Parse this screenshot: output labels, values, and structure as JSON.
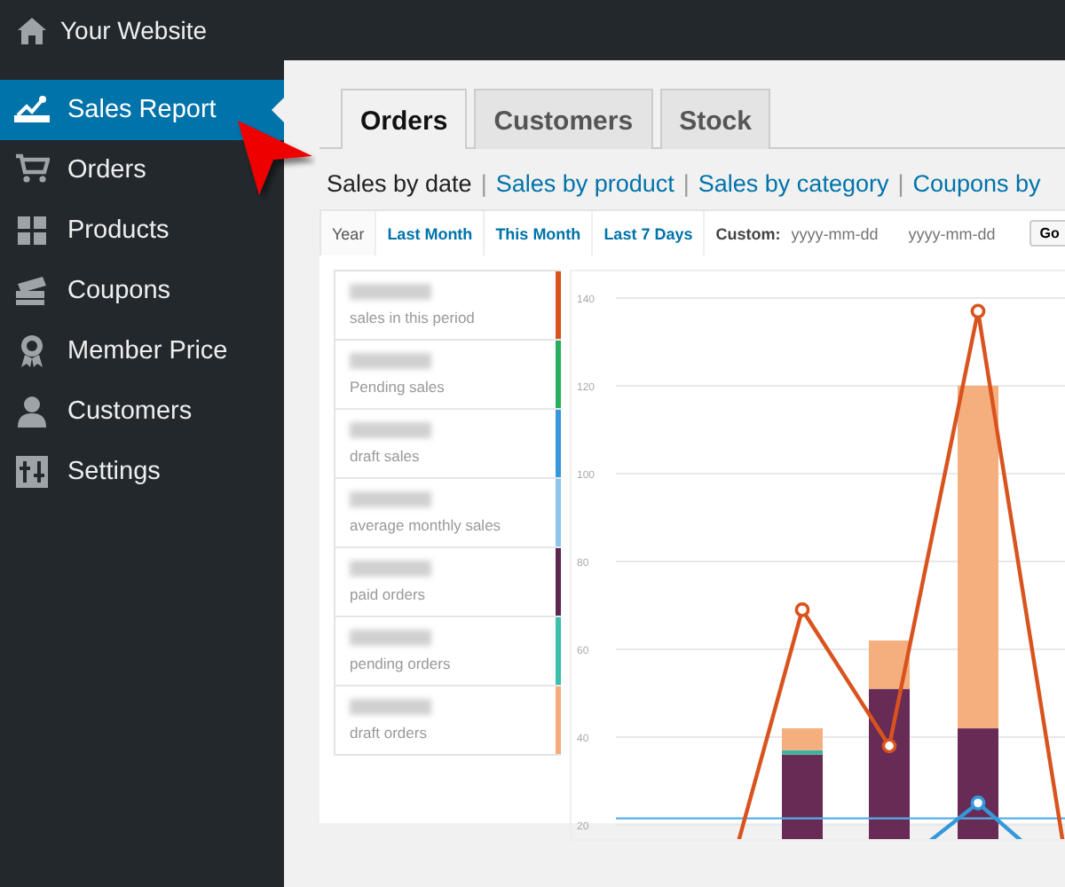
{
  "header": {
    "site_title": "Your Website"
  },
  "sidebar": {
    "items": [
      {
        "label": "Sales Report",
        "selected": true
      },
      {
        "label": "Orders",
        "selected": false
      },
      {
        "label": "Products",
        "selected": false
      },
      {
        "label": "Coupons",
        "selected": false
      },
      {
        "label": "Member Price",
        "selected": false
      },
      {
        "label": "Customers",
        "selected": false
      },
      {
        "label": "Settings",
        "selected": false
      }
    ]
  },
  "tabs": [
    {
      "label": "Orders",
      "selected": true
    },
    {
      "label": "Customers",
      "selected": false
    },
    {
      "label": "Stock",
      "selected": false
    }
  ],
  "report_nav": {
    "separator": "|",
    "links": [
      {
        "label": "Sales by date",
        "selected": true
      },
      {
        "label": "Sales by product",
        "selected": false
      },
      {
        "label": "Sales by category",
        "selected": false
      },
      {
        "label": "Coupons by",
        "selected": false
      }
    ]
  },
  "range_filter": {
    "ranges": [
      {
        "label": "Year",
        "selected": true
      },
      {
        "label": "Last Month",
        "selected": false
      },
      {
        "label": "This Month",
        "selected": false
      },
      {
        "label": "Last 7 Days",
        "selected": false
      }
    ],
    "custom_label": "Custom:",
    "start": {
      "placeholder": "yyyy-mm-dd"
    },
    "end": {
      "placeholder": "yyyy-mm-dd"
    },
    "go_button": "Go"
  },
  "summary": [
    {
      "label": "sales in this period",
      "color": "#d9531e"
    },
    {
      "label": "Pending sales",
      "color": "#27ae60"
    },
    {
      "label": "draft sales",
      "color": "#3498db"
    },
    {
      "label": "average monthly sales",
      "color": "#8ec4ec"
    },
    {
      "label": "paid orders",
      "color": "#5e2750"
    },
    {
      "label": "pending orders",
      "color": "#3bbfad"
    },
    {
      "label": "draft orders",
      "color": "#f5ab7c"
    }
  ],
  "chart": {
    "y_axis_labels": [
      "140",
      "120",
      "100",
      "80",
      "60",
      "40",
      "20"
    ]
  }
}
